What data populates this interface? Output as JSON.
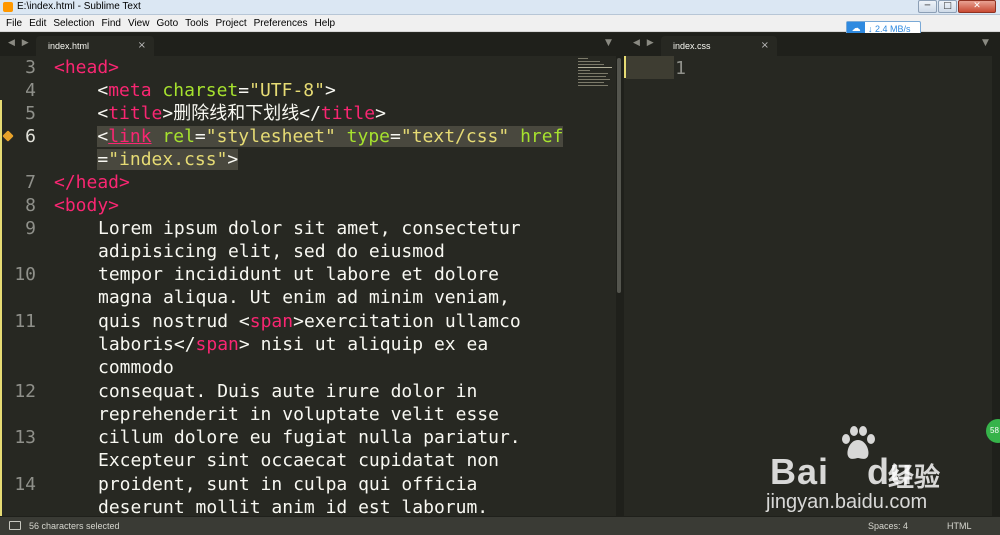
{
  "window": {
    "title": "E:\\index.html - Sublime Text",
    "minimize": "─",
    "maximize": "□",
    "close": "✕"
  },
  "menu": [
    "File",
    "Edit",
    "Selection",
    "Find",
    "View",
    "Goto",
    "Tools",
    "Project",
    "Preferences",
    "Help"
  ],
  "speed_widget": {
    "text": "↓ 2.4 MB/s"
  },
  "left_pane": {
    "nav": "◀ ▶",
    "tab": {
      "label": "index.html",
      "close": "×"
    },
    "dropdown": "▼"
  },
  "right_pane": {
    "nav": "◀ ▶",
    "tab": {
      "label": "index.css",
      "close": "×"
    },
    "dropdown": "▼",
    "line_number": "1"
  },
  "gutter_numbers": [
    "3",
    "4",
    "5",
    "6",
    "7",
    "8",
    "9",
    "10",
    "11",
    "12",
    "13",
    "14"
  ],
  "code": {
    "l3": "<head>",
    "l4": {
      "indent": "    ",
      "tag": "meta",
      "attr": "charset",
      "val": "\"UTF-8\""
    },
    "l5": {
      "indent": "    ",
      "tag": "title",
      "text": "删除线和下划线",
      "close": "title"
    },
    "l6a": {
      "indent": "    ",
      "tag": "link",
      "attr1": "rel",
      "val1": "\"stylesheet\"",
      "attr2": "type",
      "val2": "\"text/css\"",
      "attr3": "href"
    },
    "l6b": {
      "indent": "    ",
      "val": "\"index.css\""
    },
    "l7": "</head>",
    "l8": "<body>",
    "text_lines": [
      "Lorem ipsum dolor sit amet, consectetur",
      "adipisicing elit, sed do eiusmod",
      "tempor incididunt ut labore et dolore",
      "magna aliqua. Ut enim ad minim veniam,",
      "commodo",
      "consequat. Duis aute irure dolor in",
      "reprehenderit in voluptate velit esse",
      "cillum dolore eu fugiat nulla pariatur.",
      "Excepteur sint occaecat cupidatat non",
      "proident, sunt in culpa qui officia",
      "deserunt mollit anim id est laborum."
    ],
    "l11a": {
      "pre": "quis nostrud ",
      "tag": "span",
      "post": "exercitation ullamco"
    },
    "l11b": {
      "pre": "laboris</",
      "tag": "span",
      "post": "> nisi ut aliquip ex ea"
    }
  },
  "status": {
    "selection": "56 characters selected",
    "spaces": "Spaces: 4",
    "syntax": "HTML"
  },
  "watermark": {
    "logo": "Bai",
    "logo_du": "du",
    "cn": "经验",
    "url": "jingyan.baidu.com"
  },
  "badge": "58"
}
